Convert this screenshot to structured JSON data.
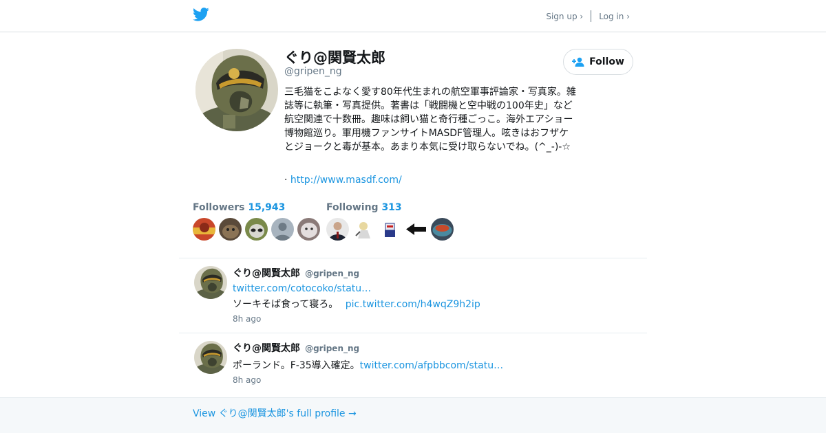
{
  "brand": {
    "logo_icon": "twitter-bird-icon",
    "color": "#1da1f2"
  },
  "topnav": {
    "signup": "Sign up ›",
    "login": "Log in ›"
  },
  "profile": {
    "name": "ぐり@関賢太郎",
    "handle": "@gripen_ng",
    "follow_label": "Follow",
    "bio": "三毛猫をこよなく愛す80年代生まれの航空軍事評論家・写真家。雑誌等に執筆・写真提供。著書は「戦闘機と空中戦の100年史」など航空関連で十数冊。趣味は飼い猫と奇行種ごっこ。海外エアショー博物館巡り。軍用機ファンサイトMASDF管理人。呟きはおフザケとジョークと毒が基本。あまり本気に受け取らないでね。(^_-)-☆",
    "website_prefix": "·",
    "website": "http://www.masdf.com/"
  },
  "stats": {
    "followers_label": "Followers",
    "followers_count": "15,943",
    "following_label": "Following",
    "following_count": "313"
  },
  "tweets": [
    {
      "name": "ぐり@関賢太郎",
      "handle": "@gripen_ng",
      "link1": "twitter.com/cotocoko/statu…",
      "text": "ソーキそば食って寝ろ。",
      "link2": "pic.twitter.com/h4wqZ9h2ip",
      "time": "8h ago"
    },
    {
      "name": "ぐり@関賢太郎",
      "handle": "@gripen_ng",
      "text": "ポーランド。F-35導入確定。",
      "link1": "twitter.com/afpbbcom/statu…",
      "time": "8h ago"
    }
  ],
  "footer": {
    "link": "View ぐり@関賢太郎's full profile →"
  },
  "colors": {
    "link": "#1b95e0",
    "muted": "#657786",
    "border": "#e6ecf0",
    "footer_bg": "#f5f8fa"
  }
}
